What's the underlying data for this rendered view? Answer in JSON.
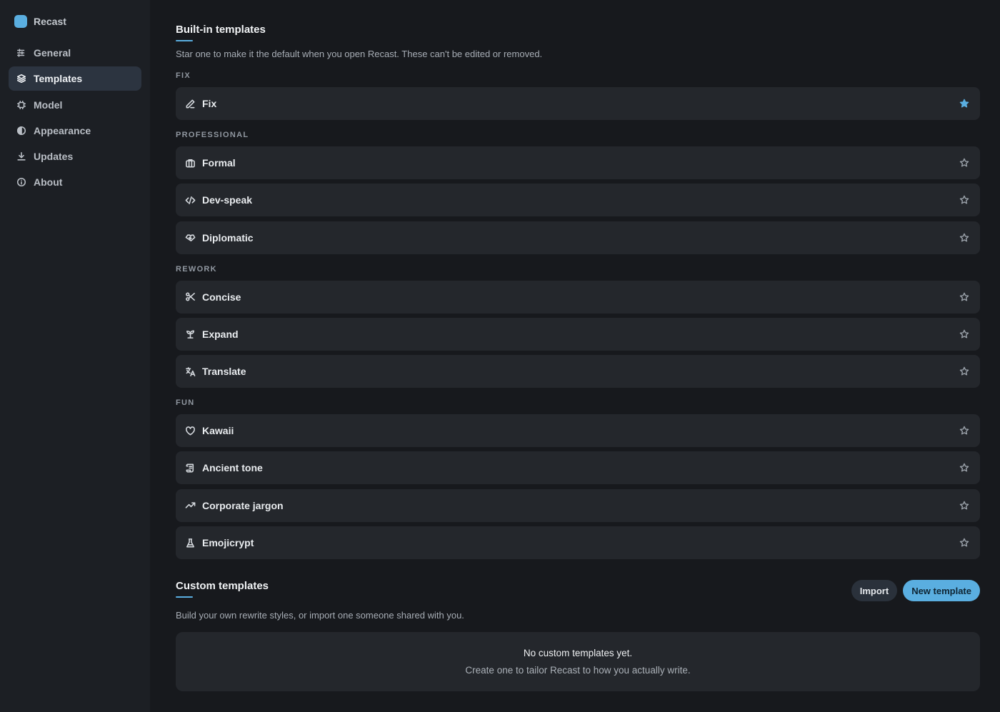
{
  "app": {
    "name": "Recast",
    "accent": "#5aaee0"
  },
  "sidebar": {
    "items": [
      {
        "label": "General",
        "icon": "sliders-icon"
      },
      {
        "label": "Templates",
        "icon": "layers-icon",
        "active": true
      },
      {
        "label": "Model",
        "icon": "chip-icon"
      },
      {
        "label": "Appearance",
        "icon": "contrast-icon"
      },
      {
        "label": "Updates",
        "icon": "download-icon"
      },
      {
        "label": "About",
        "icon": "info-icon"
      }
    ]
  },
  "builtin": {
    "title": "Built-in templates",
    "description": "Star one to make it the default when you open Recast. These can't be edited or removed.",
    "groups": [
      {
        "label": "FIX",
        "items": [
          {
            "label": "Fix",
            "icon": "pencil-icon",
            "starred": true
          }
        ]
      },
      {
        "label": "PROFESSIONAL",
        "items": [
          {
            "label": "Formal",
            "icon": "briefcase-icon",
            "starred": false
          },
          {
            "label": "Dev-speak",
            "icon": "code-icon",
            "starred": false
          },
          {
            "label": "Diplomatic",
            "icon": "handshake-icon",
            "starred": false
          }
        ]
      },
      {
        "label": "REWORK",
        "items": [
          {
            "label": "Concise",
            "icon": "scissors-icon",
            "starred": false
          },
          {
            "label": "Expand",
            "icon": "sprout-icon",
            "starred": false
          },
          {
            "label": "Translate",
            "icon": "translate-icon",
            "starred": false
          }
        ]
      },
      {
        "label": "FUN",
        "items": [
          {
            "label": "Kawaii",
            "icon": "heart-icon",
            "starred": false
          },
          {
            "label": "Ancient tone",
            "icon": "scroll-icon",
            "starred": false
          },
          {
            "label": "Corporate jargon",
            "icon": "trending-up-icon",
            "starred": false
          },
          {
            "label": "Emojicrypt",
            "icon": "flask-icon",
            "starred": false
          }
        ]
      }
    ]
  },
  "custom": {
    "title": "Custom templates",
    "description": "Build your own rewrite styles, or import one someone shared with you.",
    "import_label": "Import",
    "new_label": "New template",
    "empty_title": "No custom templates yet.",
    "empty_subtitle": "Create one to tailor Recast to how you actually write."
  }
}
